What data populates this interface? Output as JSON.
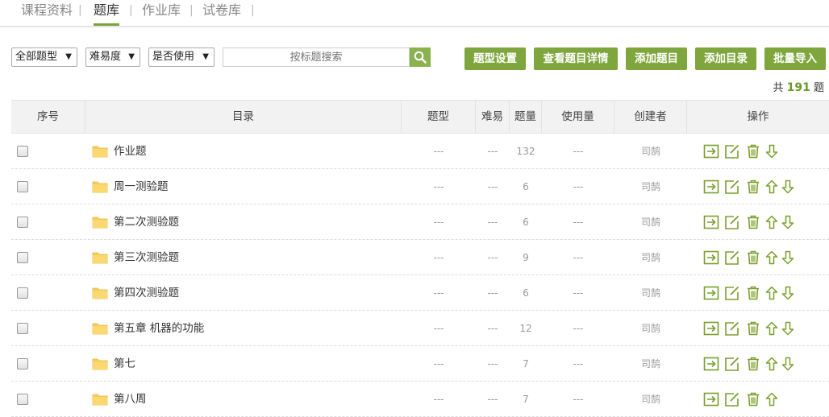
{
  "tabs": [
    {
      "label": "课程资料"
    },
    {
      "label": "题库",
      "active": true
    },
    {
      "label": "作业库"
    },
    {
      "label": "试卷库"
    }
  ],
  "filters": {
    "type": "全部题型",
    "difficulty": "难易度",
    "usage": "是否使用"
  },
  "search": {
    "placeholder": "按标题搜索"
  },
  "buttons": {
    "type_settings": "题型设置",
    "view_details": "查看题目详情",
    "add_question": "添加题目",
    "add_catalog": "添加目录",
    "batch_import": "批量导入"
  },
  "total": {
    "prefix": "共",
    "count": "191",
    "suffix": "题"
  },
  "table": {
    "headers": {
      "index": "序号",
      "catalog": "目录",
      "type": "题型",
      "difficulty": "难易",
      "count": "题量",
      "usage": "使用量",
      "creator": "创建者",
      "actions": "操作"
    },
    "rows": [
      {
        "name": "作业题",
        "type": "---",
        "difficulty": "---",
        "count": "132",
        "usage": "---",
        "creator": "司鹄",
        "up": false,
        "down": true
      },
      {
        "name": "周一测验题",
        "type": "---",
        "difficulty": "---",
        "count": "6",
        "usage": "---",
        "creator": "司鹄",
        "up": true,
        "down": true
      },
      {
        "name": "第二次测验题",
        "type": "---",
        "difficulty": "---",
        "count": "6",
        "usage": "---",
        "creator": "司鹄",
        "up": true,
        "down": true
      },
      {
        "name": "第三次测验题",
        "type": "---",
        "difficulty": "---",
        "count": "9",
        "usage": "---",
        "creator": "司鹄",
        "up": true,
        "down": true
      },
      {
        "name": "第四次测验题",
        "type": "---",
        "difficulty": "---",
        "count": "6",
        "usage": "---",
        "creator": "司鹄",
        "up": true,
        "down": true
      },
      {
        "name": "第五章 机器的功能",
        "type": "---",
        "difficulty": "---",
        "count": "12",
        "usage": "---",
        "creator": "司鹄",
        "up": true,
        "down": true
      },
      {
        "name": "第七",
        "type": "---",
        "difficulty": "---",
        "count": "7",
        "usage": "---",
        "creator": "司鹄",
        "up": true,
        "down": true
      },
      {
        "name": "第八周",
        "type": "---",
        "difficulty": "---",
        "count": "7",
        "usage": "---",
        "creator": "司鹄",
        "up": true,
        "down": false
      }
    ]
  },
  "colors": {
    "accent": "#7ea63c",
    "folder": "#f7cc5a"
  },
  "icons": {
    "move": "move-to-icon",
    "edit": "edit-icon",
    "delete": "trash-icon",
    "up": "arrow-up-icon",
    "down": "arrow-down-icon"
  }
}
